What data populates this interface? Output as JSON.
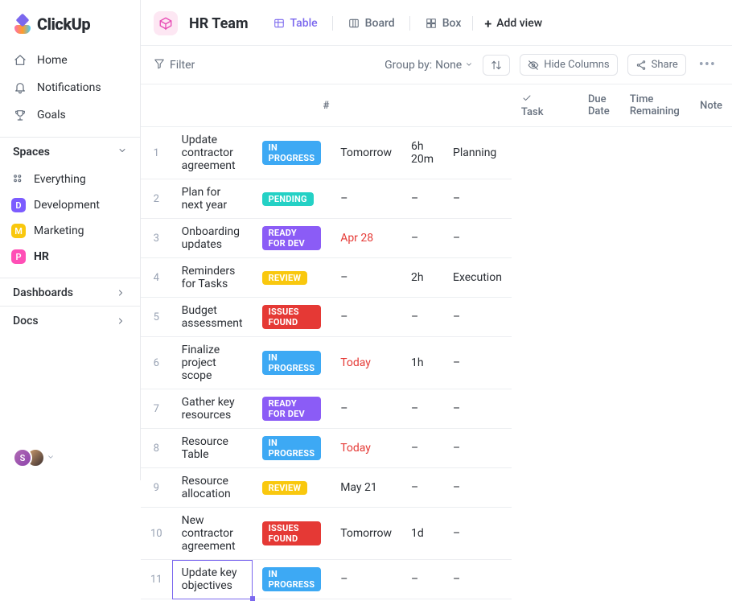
{
  "app_name": "ClickUp",
  "sidebar": {
    "nav": [
      {
        "icon": "home",
        "label": "Home"
      },
      {
        "icon": "bell",
        "label": "Notifications"
      },
      {
        "icon": "trophy",
        "label": "Goals"
      }
    ],
    "spaces_label": "Spaces",
    "everything_label": "Everything",
    "spaces": [
      {
        "letter": "D",
        "color": "#7c5cff",
        "label": "Development",
        "active": false
      },
      {
        "letter": "M",
        "color": "#f9c80e",
        "label": "Marketing",
        "active": false
      },
      {
        "letter": "P",
        "color": "#ff4fb6",
        "label": "HR",
        "active": true
      }
    ],
    "dashboards_label": "Dashboards",
    "docs_label": "Docs",
    "user_initial": "S"
  },
  "header": {
    "team_name": "HR Team",
    "views": [
      {
        "icon": "table",
        "label": "Table",
        "active": true
      },
      {
        "icon": "board",
        "label": "Board",
        "active": false
      },
      {
        "icon": "box",
        "label": "Box",
        "active": false
      }
    ],
    "add_view_label": "Add view"
  },
  "toolbar": {
    "filter_label": "Filter",
    "groupby_label": "Group by:",
    "groupby_value": "None",
    "hide_cols_label": "Hide Columns",
    "share_label": "Share"
  },
  "columns": {
    "num": "#",
    "task": "Task",
    "due_date": "Due Date",
    "time_remaining": "Time Remaining",
    "note": "Note"
  },
  "status_labels": {
    "inprogress": "IN PROGRESS",
    "pending": "PENDING",
    "readyfordev": "READY FOR DEV",
    "review": "REVIEW",
    "issuesfound": "ISSUES FOUND"
  },
  "rows": [
    {
      "n": "1",
      "task": "Update contractor agreement",
      "status": "inprogress",
      "due": "Tomorrow",
      "due_red": false,
      "time": "6h 20m",
      "note": "Planning"
    },
    {
      "n": "2",
      "task": "Plan for next year",
      "status": "pending",
      "due": "–",
      "due_red": false,
      "time": "–",
      "note": "–"
    },
    {
      "n": "3",
      "task": "Onboarding updates",
      "status": "readyfordev",
      "due": "Apr 28",
      "due_red": true,
      "time": "–",
      "note": "–"
    },
    {
      "n": "4",
      "task": "Reminders for Tasks",
      "status": "review",
      "due": "–",
      "due_red": false,
      "time": "2h",
      "note": "Execution"
    },
    {
      "n": "5",
      "task": "Budget assessment",
      "status": "issuesfound",
      "due": "–",
      "due_red": false,
      "time": "–",
      "note": "–"
    },
    {
      "n": "6",
      "task": "Finalize project scope",
      "status": "inprogress",
      "due": "Today",
      "due_red": true,
      "time": "1h",
      "note": "–"
    },
    {
      "n": "7",
      "task": "Gather key resources",
      "status": "readyfordev",
      "due": "–",
      "due_red": false,
      "time": "–",
      "note": "–"
    },
    {
      "n": "8",
      "task": "Resource Table",
      "status": "inprogress",
      "due": "Today",
      "due_red": true,
      "time": "–",
      "note": "–"
    },
    {
      "n": "9",
      "task": "Resource allocation",
      "status": "review",
      "due": "May 21",
      "due_red": false,
      "time": "–",
      "note": "–"
    },
    {
      "n": "10",
      "task": "New contractor agreement",
      "status": "issuesfound",
      "due": "Tomorrow",
      "due_red": false,
      "time": "1d",
      "note": "–"
    },
    {
      "n": "11",
      "task": "Update key objectives",
      "status": "inprogress",
      "due": "–",
      "due_red": false,
      "time": "–",
      "note": "–",
      "selected": true
    }
  ]
}
